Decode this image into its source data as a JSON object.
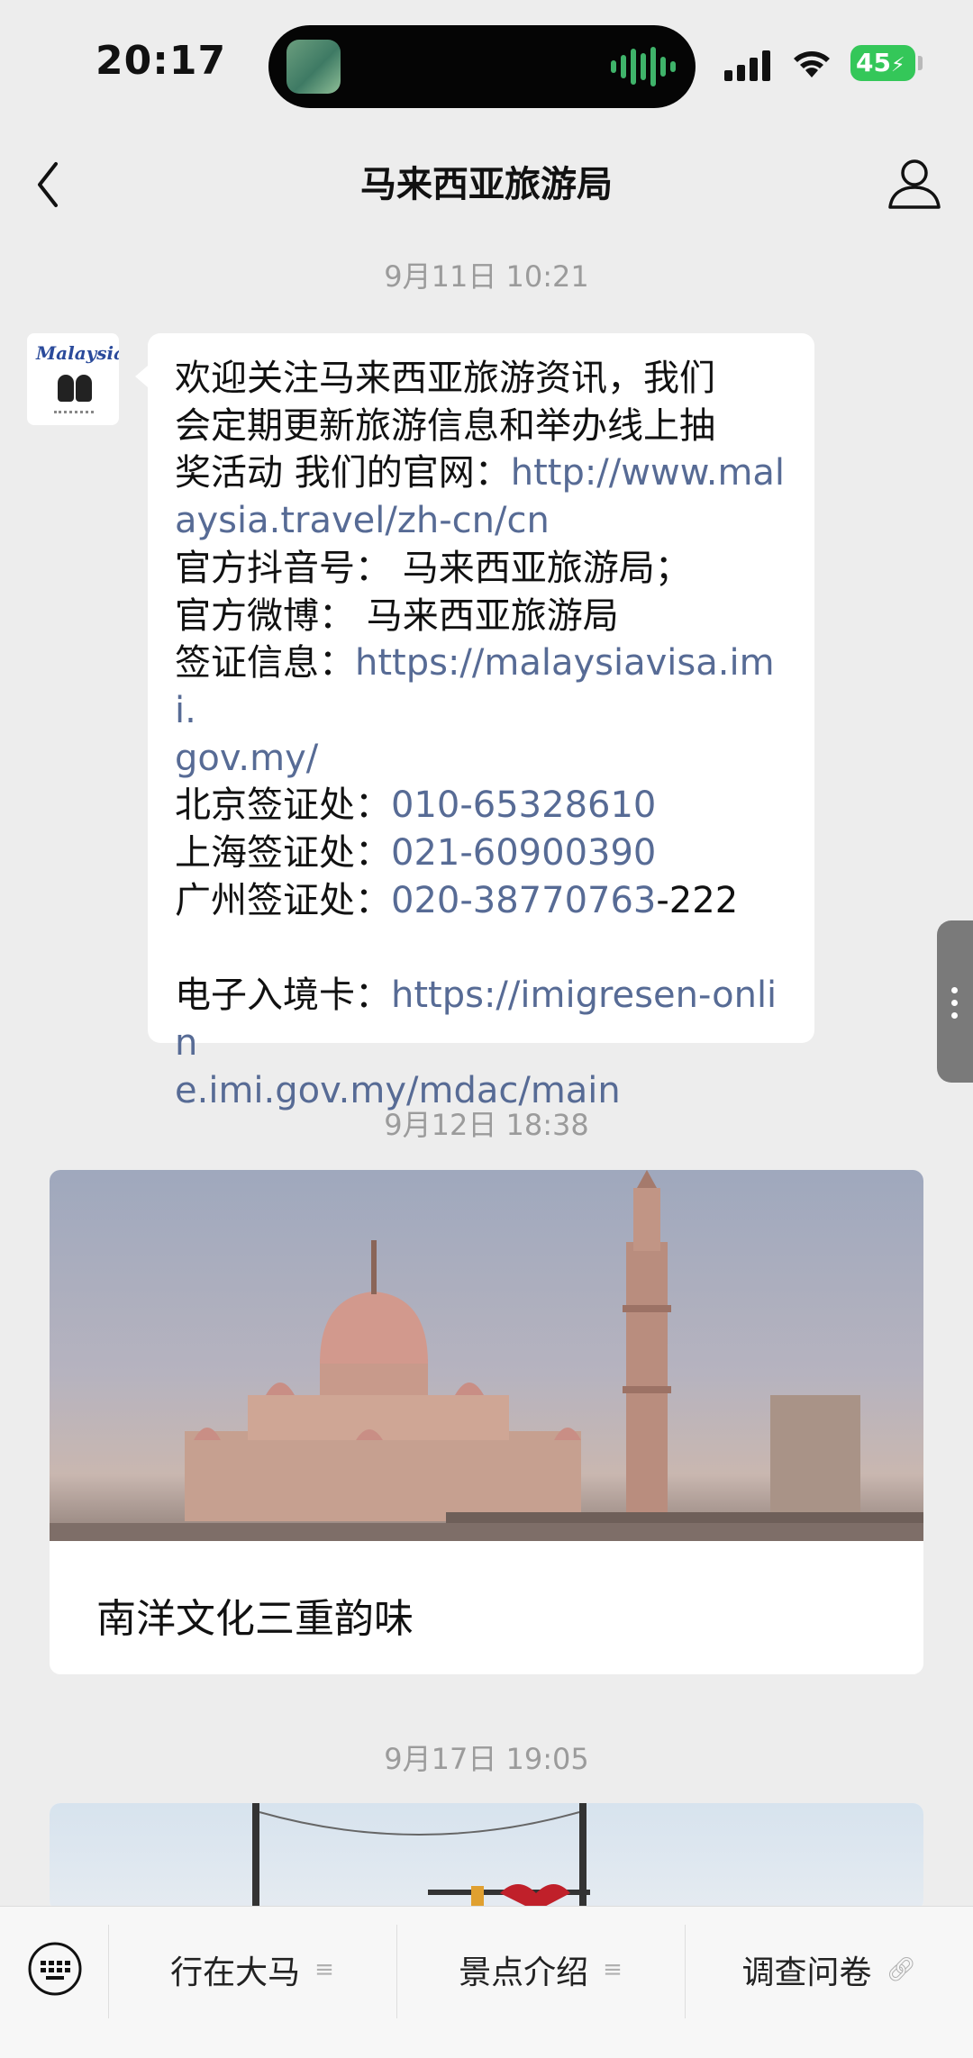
{
  "status_bar": {
    "time": "20:17",
    "battery": "45"
  },
  "header": {
    "title": "马来西亚旅游局"
  },
  "messages": [
    {
      "timestamp": "9月11日 10:21",
      "avatar_text": "Malaysia",
      "lines": [
        [
          {
            "t": "欢迎关注马来西亚旅游资讯，我们"
          }
        ],
        [
          {
            "t": "会定期更新旅游信息和举办线上抽"
          }
        ],
        [
          {
            "t": "奖活动 我们的官网："
          },
          {
            "t": "http://www.mal",
            "link": true
          }
        ],
        [
          {
            "t": "aysia.travel/zh-cn/cn",
            "link": true
          }
        ],
        [
          {
            "t": "官方抖音号：  马来西亚旅游局；"
          }
        ],
        [
          {
            "t": " 官方微博：   马来西亚旅游局"
          }
        ],
        [
          {
            "t": " 签证信息："
          },
          {
            "t": "https://malaysiavisa.imi.",
            "link": true
          }
        ],
        [
          {
            "t": "gov.my/",
            "link": true
          }
        ],
        [
          {
            "t": "北京签证处："
          },
          {
            "t": "010-65328610",
            "link": true
          }
        ],
        [
          {
            "t": "上海签证处："
          },
          {
            "t": "021-60900390",
            "link": true
          }
        ],
        [
          {
            "t": "广州签证处："
          },
          {
            "t": "020-38770763",
            "link": true
          },
          {
            "t": "-222"
          }
        ],
        [],
        [
          {
            "t": "电子入境卡："
          },
          {
            "t": "https://imigresen-onlin",
            "link": true
          }
        ],
        [
          {
            "t": "e.imi.gov.my/mdac/main",
            "link": true
          }
        ]
      ]
    },
    {
      "timestamp": "9月12日 18:38",
      "article_title": "南洋文化三重韵味"
    },
    {
      "timestamp": "9月17日 19:05"
    }
  ],
  "menu": {
    "items": [
      {
        "label": "行在大马",
        "icon": "list-icon"
      },
      {
        "label": "景点介绍",
        "icon": "list-icon"
      },
      {
        "label": "调查问卷",
        "icon": "link-icon"
      }
    ]
  },
  "colors": {
    "link": "#576b95",
    "background": "#ededed",
    "battery": "#34c759"
  }
}
